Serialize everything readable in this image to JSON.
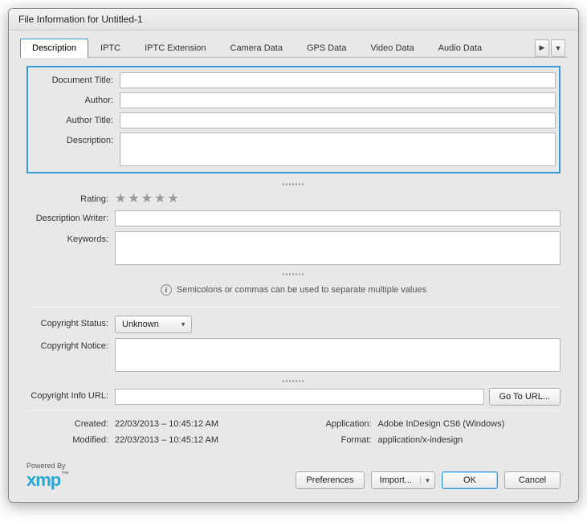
{
  "window": {
    "title": "File Information for Untitled-1"
  },
  "tabs": {
    "items": [
      "Description",
      "IPTC",
      "IPTC Extension",
      "Camera Data",
      "GPS Data",
      "Video Data",
      "Audio Data"
    ],
    "active_index": 0
  },
  "highlighted": {
    "document_title_label": "Document Title:",
    "document_title_value": "",
    "author_label": "Author:",
    "author_value": "",
    "author_title_label": "Author Title:",
    "author_title_value": "",
    "description_label": "Description:",
    "description_value": ""
  },
  "rating": {
    "label": "Rating:",
    "value": 0
  },
  "description_writer": {
    "label": "Description Writer:",
    "value": ""
  },
  "keywords": {
    "label": "Keywords:",
    "value": "",
    "hint": "Semicolons or commas can be used to separate multiple values"
  },
  "copyright": {
    "status_label": "Copyright Status:",
    "status_value": "Unknown",
    "notice_label": "Copyright Notice:",
    "notice_value": "",
    "url_label": "Copyright Info URL:",
    "url_value": "",
    "goto_label": "Go To URL..."
  },
  "meta": {
    "created_label": "Created:",
    "created_value": "22/03/2013 – 10:45:12 AM",
    "modified_label": "Modified:",
    "modified_value": "22/03/2013 – 10:45:12 AM",
    "application_label": "Application:",
    "application_value": "Adobe InDesign CS6 (Windows)",
    "format_label": "Format:",
    "format_value": "application/x-indesign"
  },
  "footer": {
    "powered_by": "Powered By",
    "logo_text": "xmp",
    "preferences": "Preferences",
    "import": "Import...",
    "ok": "OK",
    "cancel": "Cancel"
  }
}
